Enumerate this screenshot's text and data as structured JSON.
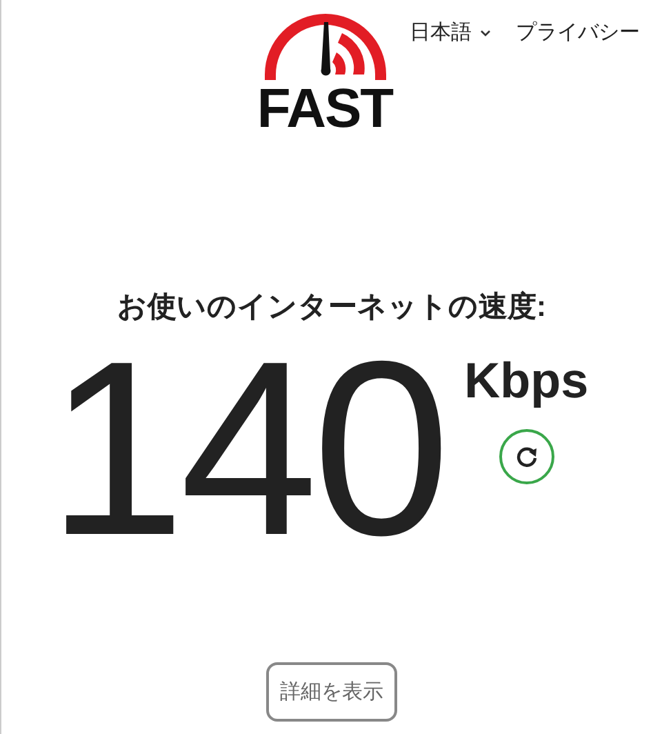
{
  "logo": {
    "text": "FAST"
  },
  "nav": [
    {
      "kind": "dropdown",
      "label": "日本語"
    },
    {
      "kind": "link",
      "label": "プライバシー"
    }
  ],
  "heading": "お使いのインターネットの速度:",
  "speed": {
    "value": "140",
    "unit": "Kbps"
  },
  "details_button": "詳細を表示"
}
